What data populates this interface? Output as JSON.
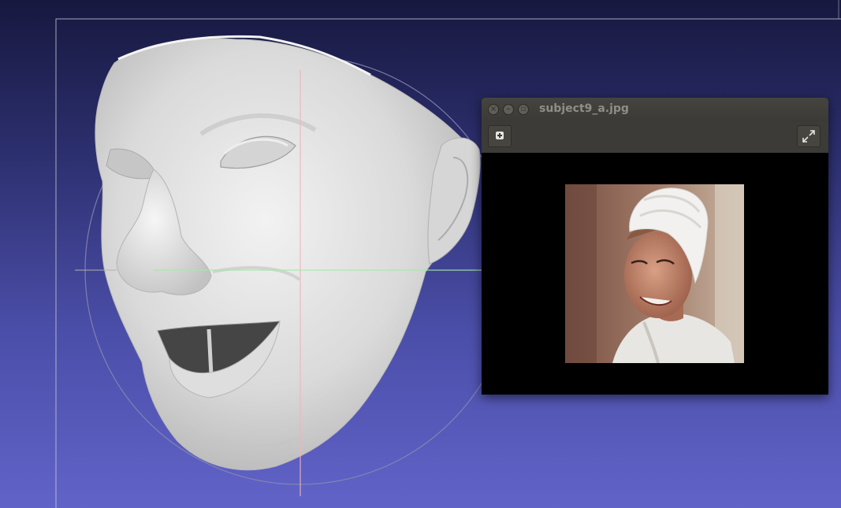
{
  "window": {
    "title": "subject9_a.jpg"
  },
  "icons": {
    "close": "close-icon",
    "minimize": "minimize-icon",
    "maximize": "maximize-icon",
    "add": "plus-icon",
    "fullscreen": "expand-icon"
  },
  "colors": {
    "background_top": "#17183f",
    "background_bottom": "#6163c8",
    "mesh": "#e3e3e3",
    "axis_vertical": "#f0b4bc",
    "axis_horizontal": "#a8e7a8",
    "window_bg": "#3c3b37",
    "title_text": "#8e8d87"
  }
}
